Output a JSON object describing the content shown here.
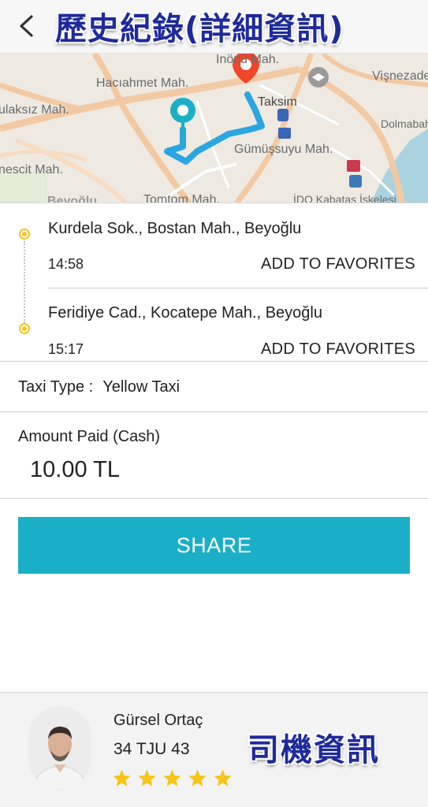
{
  "header": {
    "title": "歷史紀錄(詳細資訊)",
    "back_icon": "chevron-left-icon"
  },
  "map": {
    "labels": [
      "Hacıahmet Mah.",
      "İnönü Mah.",
      "Vişnezade",
      "ulaksız Mah.",
      "Taksim",
      "Dolmabahçe",
      "Gümüşsuyu Mah.",
      "nescit Mah.",
      "Beyoğlu",
      "Tomtom Mah.",
      "İDO Kabataş İskelesi"
    ],
    "route_color": "#2aa6e0",
    "start_pin_color": "#1aafc7",
    "end_pin_color": "#f0462a"
  },
  "trip": {
    "pickup": {
      "address": "Kurdela Sok., Bostan Mah., Beyoğlu",
      "time": "14:58",
      "favorite_label": "ADD TO FAVORITES"
    },
    "dropoff": {
      "address": "Feridiye Cad., Kocatepe Mah., Beyoğlu",
      "time": "15:17",
      "favorite_label": "ADD TO FAVORITES"
    },
    "dot_color": "#f5c518"
  },
  "taxi": {
    "label": "Taxi Type :",
    "value": "Yellow Taxi"
  },
  "payment": {
    "label": "Amount Paid (Cash)",
    "amount": "10.00 TL"
  },
  "share": {
    "label": "SHARE",
    "color": "#1aafc7"
  },
  "driver": {
    "name": "Gürsel Ortaç",
    "plate": "34 TJU 43",
    "rating": 5,
    "rating_max": 5,
    "star_color": "#f5c518",
    "info_overlay": "司機資訊"
  }
}
